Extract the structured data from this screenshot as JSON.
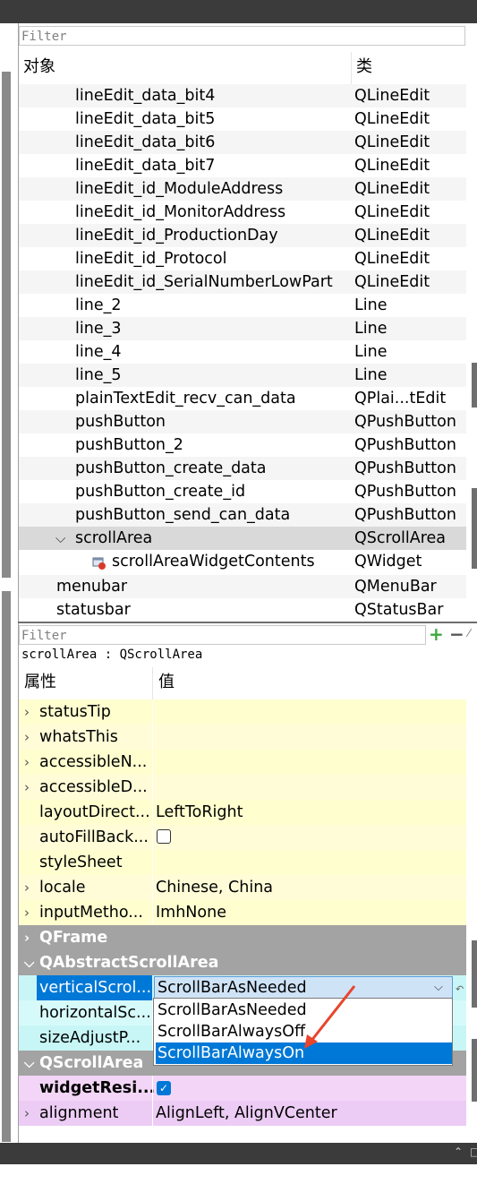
{
  "object_inspector": {
    "filter_placeholder": "Filter",
    "col_object": "对象",
    "col_class": "类",
    "rows": [
      {
        "name": "lineEdit_data_bit4",
        "class": "QLineEdit"
      },
      {
        "name": "lineEdit_data_bit5",
        "class": "QLineEdit"
      },
      {
        "name": "lineEdit_data_bit6",
        "class": "QLineEdit"
      },
      {
        "name": "lineEdit_data_bit7",
        "class": "QLineEdit"
      },
      {
        "name": "lineEdit_id_ModuleAddress",
        "class": "QLineEdit"
      },
      {
        "name": "lineEdit_id_MonitorAddress",
        "class": "QLineEdit"
      },
      {
        "name": "lineEdit_id_ProductionDay",
        "class": "QLineEdit"
      },
      {
        "name": "lineEdit_id_Protocol",
        "class": "QLineEdit"
      },
      {
        "name": "lineEdit_id_SerialNumberLowPart",
        "class": "QLineEdit"
      },
      {
        "name": "line_2",
        "class": "Line"
      },
      {
        "name": "line_3",
        "class": "Line"
      },
      {
        "name": "line_4",
        "class": "Line"
      },
      {
        "name": "line_5",
        "class": "Line"
      },
      {
        "name": "plainTextEdit_recv_can_data",
        "class": "QPlai...tEdit"
      },
      {
        "name": "pushButton",
        "class": "QPushButton"
      },
      {
        "name": "pushButton_2",
        "class": "QPushButton"
      },
      {
        "name": "pushButton_create_data",
        "class": "QPushButton"
      },
      {
        "name": "pushButton_create_id",
        "class": "QPushButton"
      },
      {
        "name": "pushButton_send_can_data",
        "class": "QPushButton"
      },
      {
        "name": "scrollArea",
        "class": "QScrollArea"
      },
      {
        "name": "scrollAreaWidgetContents",
        "class": "QWidget"
      },
      {
        "name": "menubar",
        "class": "QMenuBar"
      },
      {
        "name": "statusbar",
        "class": "QStatusBar"
      }
    ]
  },
  "property_editor": {
    "filter_placeholder": "Filter",
    "plus_icon": "+",
    "minus_icon": "−",
    "object_label": "scrollArea : QScrollArea",
    "col_property": "属性",
    "col_value": "值",
    "rows": [
      {
        "name": "statusTip",
        "value": ""
      },
      {
        "name": "whatsThis",
        "value": ""
      },
      {
        "name": "accessibleN...",
        "value": ""
      },
      {
        "name": "accessibleD...",
        "value": ""
      },
      {
        "name": "layoutDirect...",
        "value": "LeftToRight"
      },
      {
        "name": "autoFillBack...",
        "value": ""
      },
      {
        "name": "styleSheet",
        "value": ""
      },
      {
        "name": "locale",
        "value": "Chinese, China"
      },
      {
        "name": "inputMetho...",
        "value": "ImhNone"
      },
      {
        "name": "QFrame",
        "value": ""
      },
      {
        "name": "QAbstractScrollArea",
        "value": ""
      },
      {
        "name": "verticalScrol...",
        "value": "ScrollBarAsNeeded"
      },
      {
        "name": "horizontalSc...",
        "value": ""
      },
      {
        "name": "sizeAdjustP...",
        "value": ""
      },
      {
        "name": "QScrollArea",
        "value": ""
      },
      {
        "name": "widgetResi...",
        "value": ""
      },
      {
        "name": "alignment",
        "value": "AlignLeft, AlignVCenter"
      }
    ],
    "dropdown_options": [
      "ScrollBarAsNeeded",
      "ScrollBarAlwaysOff",
      "ScrollBarAlwaysOn"
    ],
    "dropdown_selected": "ScrollBarAlwaysOn",
    "autofill_checked": false,
    "widget_resizable_checked": true
  },
  "colors": {
    "selection_blue": "#0078d7",
    "annotation_red": "#e8452c",
    "group_gray": "#a3a3a3"
  },
  "icons": [
    "expand-chevron-icon",
    "collapse-chevron-icon",
    "widget-icon",
    "add-property-icon",
    "remove-property-icon",
    "reset-icon",
    "red-annotation-arrow"
  ]
}
